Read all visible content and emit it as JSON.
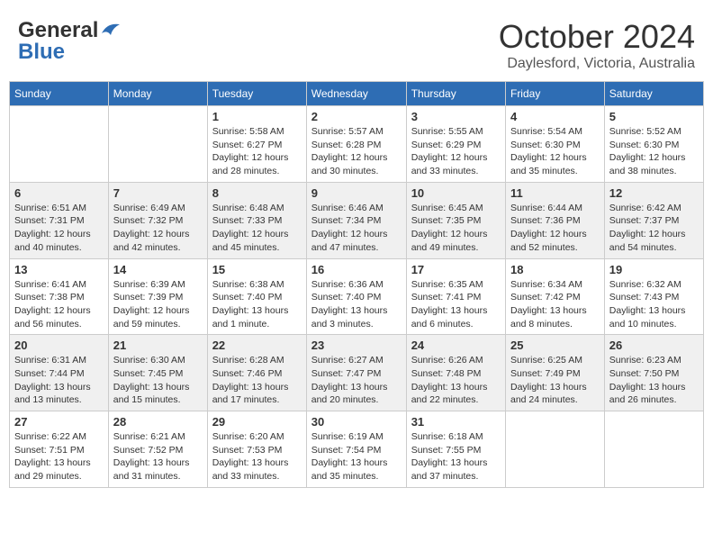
{
  "logo": {
    "general": "General",
    "blue": "Blue"
  },
  "header": {
    "month": "October 2024",
    "location": "Daylesford, Victoria, Australia"
  },
  "weekdays": [
    "Sunday",
    "Monday",
    "Tuesday",
    "Wednesday",
    "Thursday",
    "Friday",
    "Saturday"
  ],
  "weeks": [
    [
      {
        "day": "",
        "sunrise": "",
        "sunset": "",
        "daylight": ""
      },
      {
        "day": "",
        "sunrise": "",
        "sunset": "",
        "daylight": ""
      },
      {
        "day": "1",
        "sunrise": "Sunrise: 5:58 AM",
        "sunset": "Sunset: 6:27 PM",
        "daylight": "Daylight: 12 hours and 28 minutes."
      },
      {
        "day": "2",
        "sunrise": "Sunrise: 5:57 AM",
        "sunset": "Sunset: 6:28 PM",
        "daylight": "Daylight: 12 hours and 30 minutes."
      },
      {
        "day": "3",
        "sunrise": "Sunrise: 5:55 AM",
        "sunset": "Sunset: 6:29 PM",
        "daylight": "Daylight: 12 hours and 33 minutes."
      },
      {
        "day": "4",
        "sunrise": "Sunrise: 5:54 AM",
        "sunset": "Sunset: 6:30 PM",
        "daylight": "Daylight: 12 hours and 35 minutes."
      },
      {
        "day": "5",
        "sunrise": "Sunrise: 5:52 AM",
        "sunset": "Sunset: 6:30 PM",
        "daylight": "Daylight: 12 hours and 38 minutes."
      }
    ],
    [
      {
        "day": "6",
        "sunrise": "Sunrise: 6:51 AM",
        "sunset": "Sunset: 7:31 PM",
        "daylight": "Daylight: 12 hours and 40 minutes."
      },
      {
        "day": "7",
        "sunrise": "Sunrise: 6:49 AM",
        "sunset": "Sunset: 7:32 PM",
        "daylight": "Daylight: 12 hours and 42 minutes."
      },
      {
        "day": "8",
        "sunrise": "Sunrise: 6:48 AM",
        "sunset": "Sunset: 7:33 PM",
        "daylight": "Daylight: 12 hours and 45 minutes."
      },
      {
        "day": "9",
        "sunrise": "Sunrise: 6:46 AM",
        "sunset": "Sunset: 7:34 PM",
        "daylight": "Daylight: 12 hours and 47 minutes."
      },
      {
        "day": "10",
        "sunrise": "Sunrise: 6:45 AM",
        "sunset": "Sunset: 7:35 PM",
        "daylight": "Daylight: 12 hours and 49 minutes."
      },
      {
        "day": "11",
        "sunrise": "Sunrise: 6:44 AM",
        "sunset": "Sunset: 7:36 PM",
        "daylight": "Daylight: 12 hours and 52 minutes."
      },
      {
        "day": "12",
        "sunrise": "Sunrise: 6:42 AM",
        "sunset": "Sunset: 7:37 PM",
        "daylight": "Daylight: 12 hours and 54 minutes."
      }
    ],
    [
      {
        "day": "13",
        "sunrise": "Sunrise: 6:41 AM",
        "sunset": "Sunset: 7:38 PM",
        "daylight": "Daylight: 12 hours and 56 minutes."
      },
      {
        "day": "14",
        "sunrise": "Sunrise: 6:39 AM",
        "sunset": "Sunset: 7:39 PM",
        "daylight": "Daylight: 12 hours and 59 minutes."
      },
      {
        "day": "15",
        "sunrise": "Sunrise: 6:38 AM",
        "sunset": "Sunset: 7:40 PM",
        "daylight": "Daylight: 13 hours and 1 minute."
      },
      {
        "day": "16",
        "sunrise": "Sunrise: 6:36 AM",
        "sunset": "Sunset: 7:40 PM",
        "daylight": "Daylight: 13 hours and 3 minutes."
      },
      {
        "day": "17",
        "sunrise": "Sunrise: 6:35 AM",
        "sunset": "Sunset: 7:41 PM",
        "daylight": "Daylight: 13 hours and 6 minutes."
      },
      {
        "day": "18",
        "sunrise": "Sunrise: 6:34 AM",
        "sunset": "Sunset: 7:42 PM",
        "daylight": "Daylight: 13 hours and 8 minutes."
      },
      {
        "day": "19",
        "sunrise": "Sunrise: 6:32 AM",
        "sunset": "Sunset: 7:43 PM",
        "daylight": "Daylight: 13 hours and 10 minutes."
      }
    ],
    [
      {
        "day": "20",
        "sunrise": "Sunrise: 6:31 AM",
        "sunset": "Sunset: 7:44 PM",
        "daylight": "Daylight: 13 hours and 13 minutes."
      },
      {
        "day": "21",
        "sunrise": "Sunrise: 6:30 AM",
        "sunset": "Sunset: 7:45 PM",
        "daylight": "Daylight: 13 hours and 15 minutes."
      },
      {
        "day": "22",
        "sunrise": "Sunrise: 6:28 AM",
        "sunset": "Sunset: 7:46 PM",
        "daylight": "Daylight: 13 hours and 17 minutes."
      },
      {
        "day": "23",
        "sunrise": "Sunrise: 6:27 AM",
        "sunset": "Sunset: 7:47 PM",
        "daylight": "Daylight: 13 hours and 20 minutes."
      },
      {
        "day": "24",
        "sunrise": "Sunrise: 6:26 AM",
        "sunset": "Sunset: 7:48 PM",
        "daylight": "Daylight: 13 hours and 22 minutes."
      },
      {
        "day": "25",
        "sunrise": "Sunrise: 6:25 AM",
        "sunset": "Sunset: 7:49 PM",
        "daylight": "Daylight: 13 hours and 24 minutes."
      },
      {
        "day": "26",
        "sunrise": "Sunrise: 6:23 AM",
        "sunset": "Sunset: 7:50 PM",
        "daylight": "Daylight: 13 hours and 26 minutes."
      }
    ],
    [
      {
        "day": "27",
        "sunrise": "Sunrise: 6:22 AM",
        "sunset": "Sunset: 7:51 PM",
        "daylight": "Daylight: 13 hours and 29 minutes."
      },
      {
        "day": "28",
        "sunrise": "Sunrise: 6:21 AM",
        "sunset": "Sunset: 7:52 PM",
        "daylight": "Daylight: 13 hours and 31 minutes."
      },
      {
        "day": "29",
        "sunrise": "Sunrise: 6:20 AM",
        "sunset": "Sunset: 7:53 PM",
        "daylight": "Daylight: 13 hours and 33 minutes."
      },
      {
        "day": "30",
        "sunrise": "Sunrise: 6:19 AM",
        "sunset": "Sunset: 7:54 PM",
        "daylight": "Daylight: 13 hours and 35 minutes."
      },
      {
        "day": "31",
        "sunrise": "Sunrise: 6:18 AM",
        "sunset": "Sunset: 7:55 PM",
        "daylight": "Daylight: 13 hours and 37 minutes."
      },
      {
        "day": "",
        "sunrise": "",
        "sunset": "",
        "daylight": ""
      },
      {
        "day": "",
        "sunrise": "",
        "sunset": "",
        "daylight": ""
      }
    ]
  ]
}
